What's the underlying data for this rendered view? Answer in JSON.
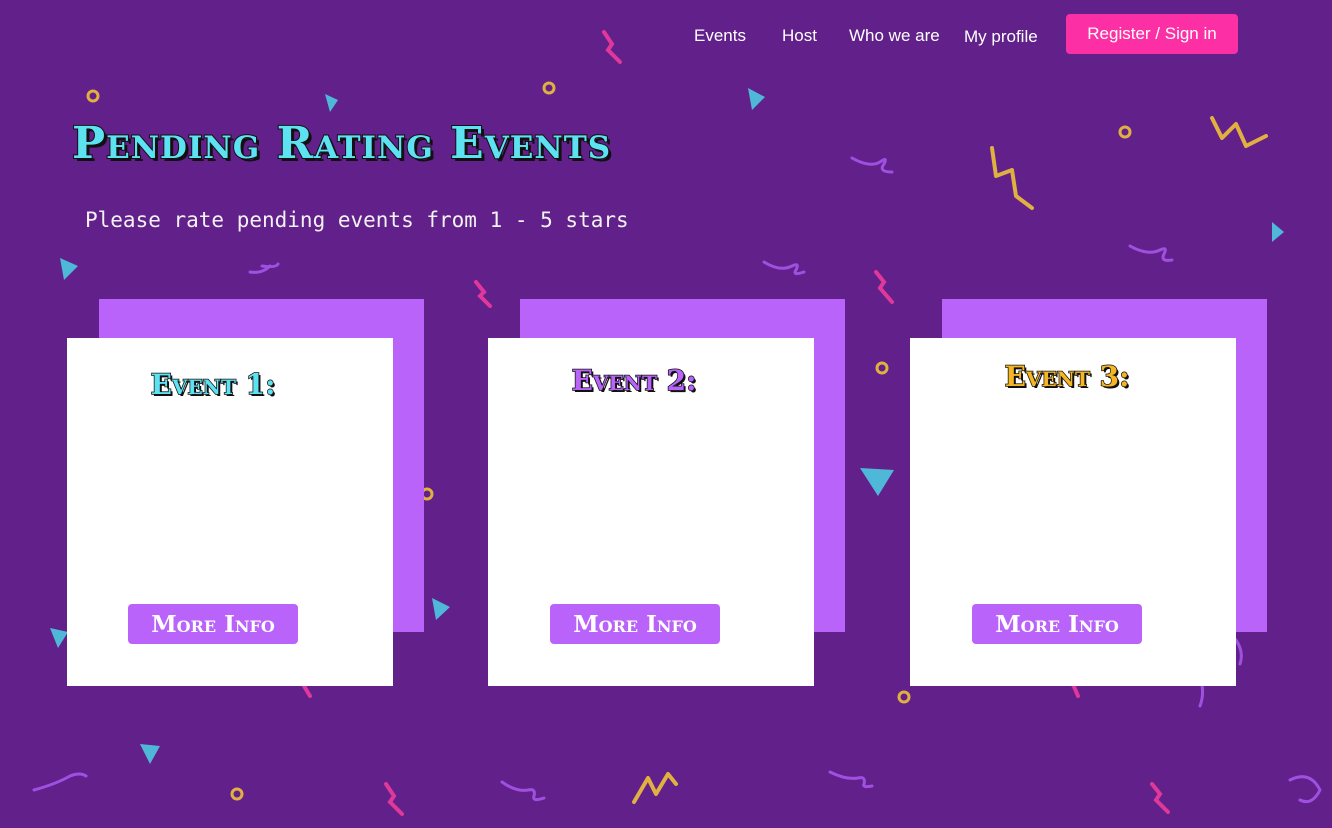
{
  "nav": {
    "links": [
      "Events",
      "Host",
      "Who we are",
      "My profile"
    ],
    "cta_label": "Register / Sign in"
  },
  "page": {
    "title": "Pending Rating Events",
    "subtitle": "Please rate pending events from 1 - 5 stars"
  },
  "events": [
    {
      "title": "Event 1:",
      "title_color": "#5de2f2",
      "button_label": "More Info"
    },
    {
      "title": "Event 2:",
      "title_color": "#b963fb",
      "button_label": "More Info"
    },
    {
      "title": "Event 3:",
      "title_color": "#f5b623",
      "button_label": "More Info"
    }
  ],
  "colors": {
    "background": "#62208a",
    "accent_pink": "#fd2fa4",
    "accent_purple": "#b963fb",
    "accent_cyan": "#5de2f2",
    "accent_yellow": "#f5b623"
  }
}
